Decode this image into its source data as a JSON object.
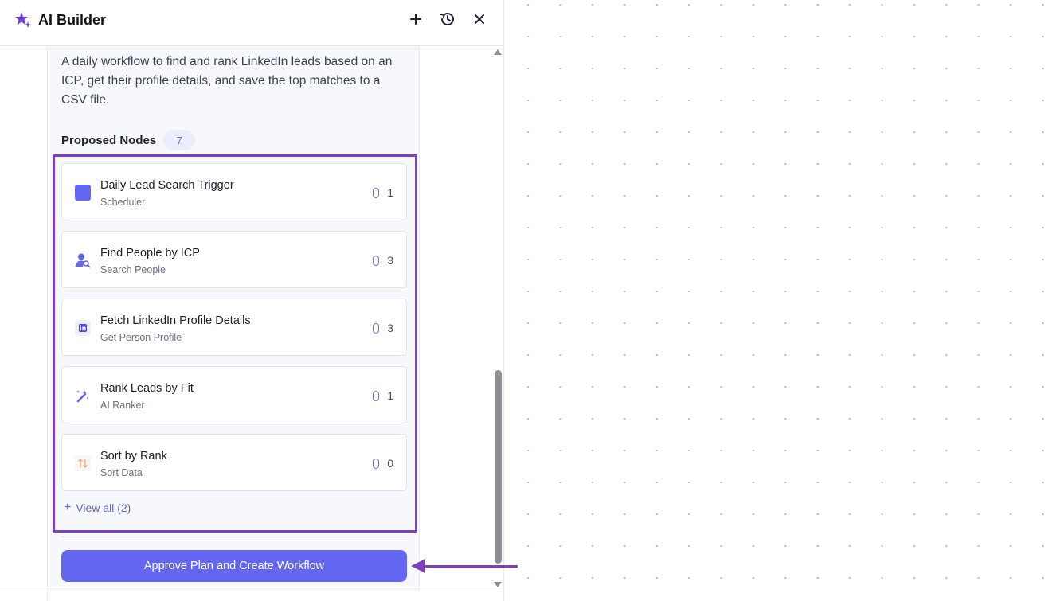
{
  "header": {
    "title": "AI Builder",
    "icons": [
      "sparkle-star-icon",
      "plus-icon",
      "history-icon",
      "close-icon"
    ]
  },
  "description": "A daily workflow to find and rank LinkedIn leads based on an ICP, get their profile details, and save the top matches to a CSV file.",
  "proposed": {
    "label": "Proposed Nodes",
    "count": "7"
  },
  "nodes": [
    {
      "name": "Daily Lead Search Trigger",
      "type": "Scheduler",
      "count": "1",
      "icon": "scheduler-square-icon",
      "color": "#6366f1"
    },
    {
      "name": "Find People by ICP",
      "type": "Search People",
      "count": "3",
      "icon": "person-search-icon",
      "color": "#6366f1"
    },
    {
      "name": "Fetch LinkedIn Profile Details",
      "type": "Get Person Profile",
      "count": "3",
      "icon": "linkedin-icon",
      "color": "#4f46e5"
    },
    {
      "name": "Rank Leads by Fit",
      "type": "AI Ranker",
      "count": "1",
      "icon": "magic-wand-icon",
      "color": "#6366f1"
    },
    {
      "name": "Sort by Rank",
      "type": "Sort Data",
      "count": "0",
      "icon": "sort-arrows-icon",
      "color": "#f5a26a"
    }
  ],
  "view_all": "View all (2)",
  "approve_button": "Approve Plan and Create Workflow",
  "colors": {
    "accent": "#6366f1",
    "annotation": "#7f3fbf"
  }
}
